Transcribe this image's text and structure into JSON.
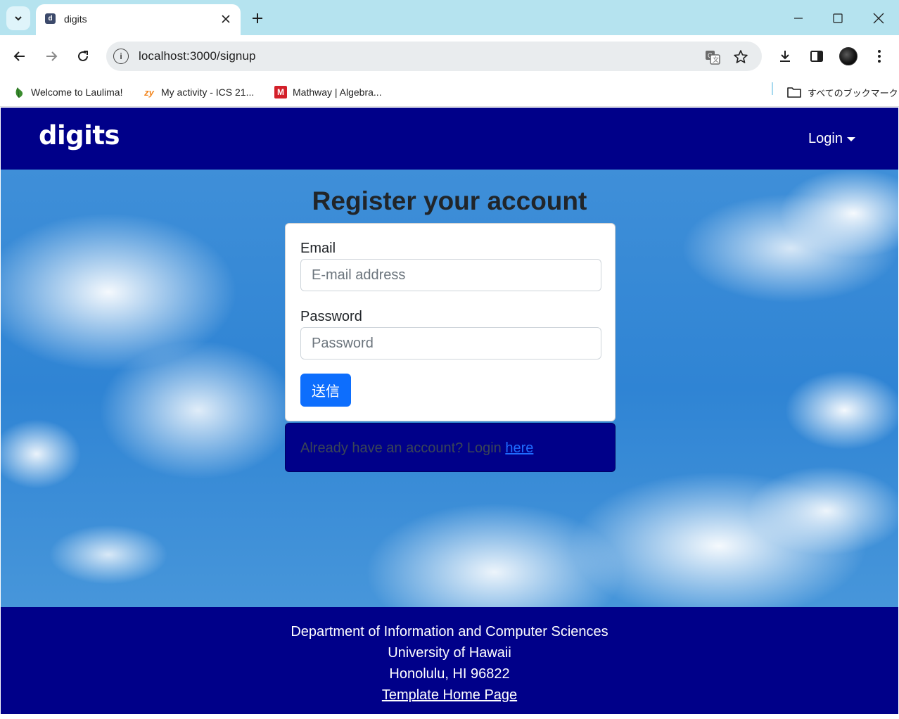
{
  "browser": {
    "tab_title": "digits",
    "url": "localhost:3000/signup",
    "bookmarks": [
      {
        "label": "Welcome to Laulima!",
        "icon": "leaf-icon"
      },
      {
        "label": "My activity - ICS 21...",
        "icon": "zybooks-icon",
        "badge": "zy"
      },
      {
        "label": "Mathway | Algebra...",
        "icon": "mathway-icon",
        "badge": "M"
      }
    ],
    "all_bookmarks_label": "すべてのブックマーク"
  },
  "navbar": {
    "brand": "digits",
    "login_label": "Login"
  },
  "signup": {
    "title": "Register your account",
    "email_label": "Email",
    "email_placeholder": "E-mail address",
    "password_label": "Password",
    "password_placeholder": "Password",
    "submit_label": "送信",
    "login_prompt": "Already have an account? Login ",
    "login_link": "here"
  },
  "footer": {
    "line1": "Department of Information and Computer Sciences",
    "line2": "University of Hawaii",
    "line3": "Honolulu, HI 96822",
    "link": "Template Home Page"
  },
  "colors": {
    "navbar_bg": "#000089",
    "primary_button": "#0d6efd",
    "tabstrip": "#b5e3ef"
  }
}
